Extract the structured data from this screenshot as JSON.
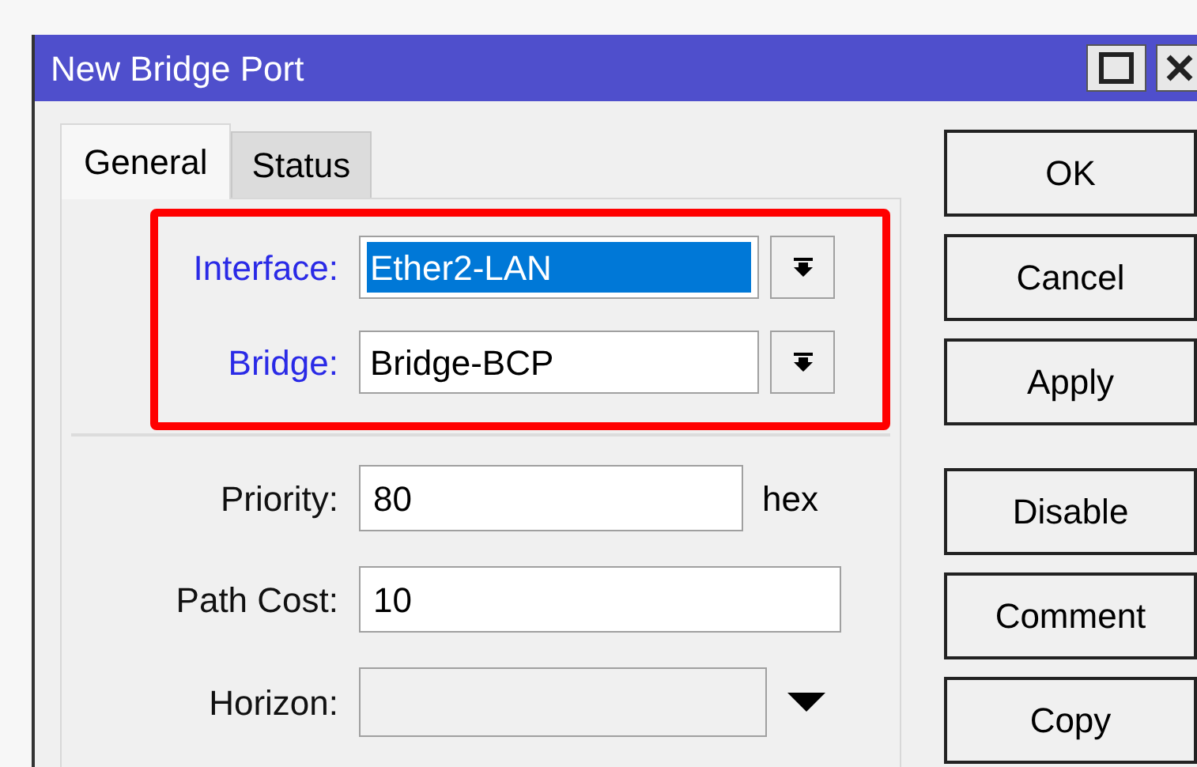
{
  "window": {
    "title": "New Bridge Port"
  },
  "tabs": [
    {
      "label": "General",
      "selected": true
    },
    {
      "label": "Status",
      "selected": false
    }
  ],
  "highlighted_fields": [
    {
      "label": "Interface:",
      "kind": "dropdown",
      "value": "Ether2-LAN",
      "value_selected": true,
      "required": true,
      "disabled": false
    },
    {
      "label": "Bridge:",
      "kind": "dropdown",
      "value": "Bridge-BCP",
      "value_selected": false,
      "required": true,
      "disabled": false
    }
  ],
  "fields": [
    {
      "label": "Priority:",
      "kind": "text",
      "value": "80",
      "unit": "hex",
      "value_selected": false,
      "required": false,
      "disabled": false
    },
    {
      "label": "Path Cost:",
      "kind": "text",
      "value": "10",
      "value_selected": false,
      "required": false,
      "disabled": false
    },
    {
      "label": "Horizon:",
      "kind": "select",
      "required": false,
      "disabled": true
    }
  ],
  "button_groups": [
    [
      {
        "label": "OK"
      },
      {
        "label": "Cancel"
      },
      {
        "label": "Apply"
      }
    ],
    [
      {
        "label": "Disable"
      },
      {
        "label": "Comment"
      },
      {
        "label": "Copy"
      }
    ]
  ]
}
